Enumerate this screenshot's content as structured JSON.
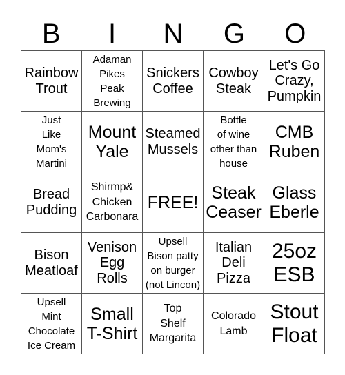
{
  "title_letters": [
    "B",
    "I",
    "N",
    "G",
    "O"
  ],
  "cells": [
    {
      "text": "Rainbow\nTrout",
      "size": "s-md"
    },
    {
      "text": "Adaman\nPikes\nPeak\nBrewing",
      "size": "s-xs"
    },
    {
      "text": "Snickers\nCoffee",
      "size": "s-md"
    },
    {
      "text": "Cowboy\nSteak",
      "size": "s-md"
    },
    {
      "text": "Let's Go\nCrazy,\nPumpkin",
      "size": "s-md"
    },
    {
      "text": "Just\nLike\nMom's\nMartini",
      "size": "s-xs"
    },
    {
      "text": "Mount\nYale",
      "size": "s-lg"
    },
    {
      "text": "Steamed\nMussels",
      "size": "s-md"
    },
    {
      "text": "Bottle\nof wine\nother than\nhouse",
      "size": "s-xs"
    },
    {
      "text": "CMB\nRuben",
      "size": "s-lg"
    },
    {
      "text": "Bread\nPudding",
      "size": "s-md"
    },
    {
      "text": "Shirmp&\nChicken\nCarbonara",
      "size": "s-sm"
    },
    {
      "text": "FREE!",
      "size": "s-lg"
    },
    {
      "text": "Steak\nCeaser",
      "size": "s-lg"
    },
    {
      "text": "Glass\nEberle",
      "size": "s-lg"
    },
    {
      "text": "Bison\nMeatloaf",
      "size": "s-md"
    },
    {
      "text": "Venison\nEgg\nRolls",
      "size": "s-md"
    },
    {
      "text": "Upsell\nBison patty\non burger\n(not Lincon)",
      "size": "s-xs"
    },
    {
      "text": "Italian\nDeli\nPizza",
      "size": "s-md"
    },
    {
      "text": "25oz\nESB",
      "size": "s-xl"
    },
    {
      "text": "Upsell\nMint\nChocolate\nIce Cream",
      "size": "s-xs"
    },
    {
      "text": "Small\nT-Shirt",
      "size": "s-lg"
    },
    {
      "text": "Top\nShelf\nMargarita",
      "size": "s-sm"
    },
    {
      "text": "Colorado\nLamb",
      "size": "s-sm"
    },
    {
      "text": "Stout\nFloat",
      "size": "s-xl"
    }
  ]
}
